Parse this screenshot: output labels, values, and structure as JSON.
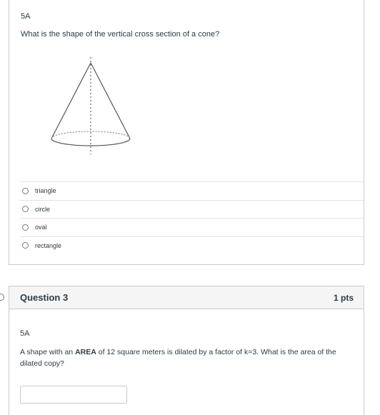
{
  "question1": {
    "label": "5A",
    "text": "What is the shape of the vertical cross section of a cone?",
    "answers": [
      "triangle",
      "circle",
      "oval",
      "rectangle"
    ]
  },
  "question3": {
    "title": "Question 3",
    "points": "1 pts",
    "label": "5A",
    "text_before": "A shape with an ",
    "text_bold": "AREA",
    "text_after": " of 12 square meters is dilated by a factor of k=3. What is the area of the dilated copy?",
    "answer_value": ""
  }
}
